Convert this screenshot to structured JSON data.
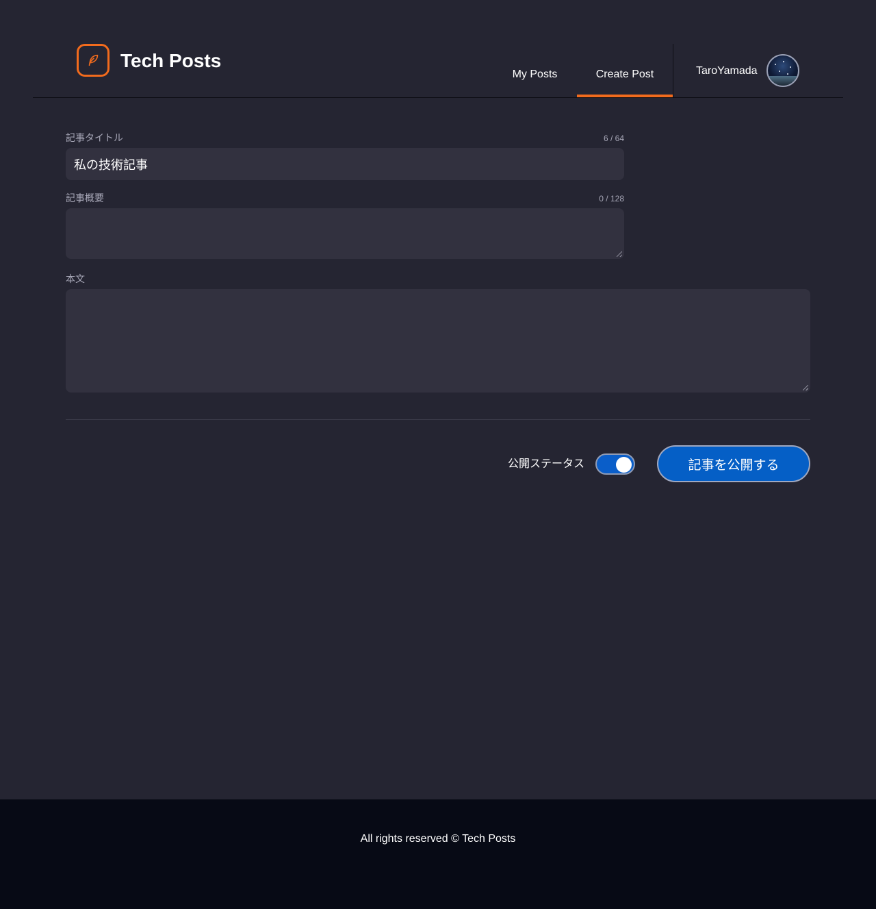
{
  "header": {
    "brand": "Tech Posts",
    "nav": [
      {
        "label": "My Posts",
        "active": false
      },
      {
        "label": "Create Post",
        "active": true
      }
    ],
    "user_name": "TaroYamada",
    "accent_color": "#f26b1d"
  },
  "form": {
    "title": {
      "label": "記事タイトル",
      "value": "私の技術記事",
      "counter": "6 / 64"
    },
    "summary": {
      "label": "記事概要",
      "value": "",
      "counter": "0 / 128"
    },
    "body": {
      "label": "本文",
      "value": ""
    },
    "publish_status": {
      "label": "公開ステータス",
      "on": true
    },
    "publish_button": "記事を公開する"
  },
  "footer": {
    "text": "All rights reserved © Tech Posts"
  },
  "colors": {
    "background": "#252532",
    "input_background": "#32313f",
    "primary": "#055fc6",
    "footer_background": "#070a15"
  }
}
